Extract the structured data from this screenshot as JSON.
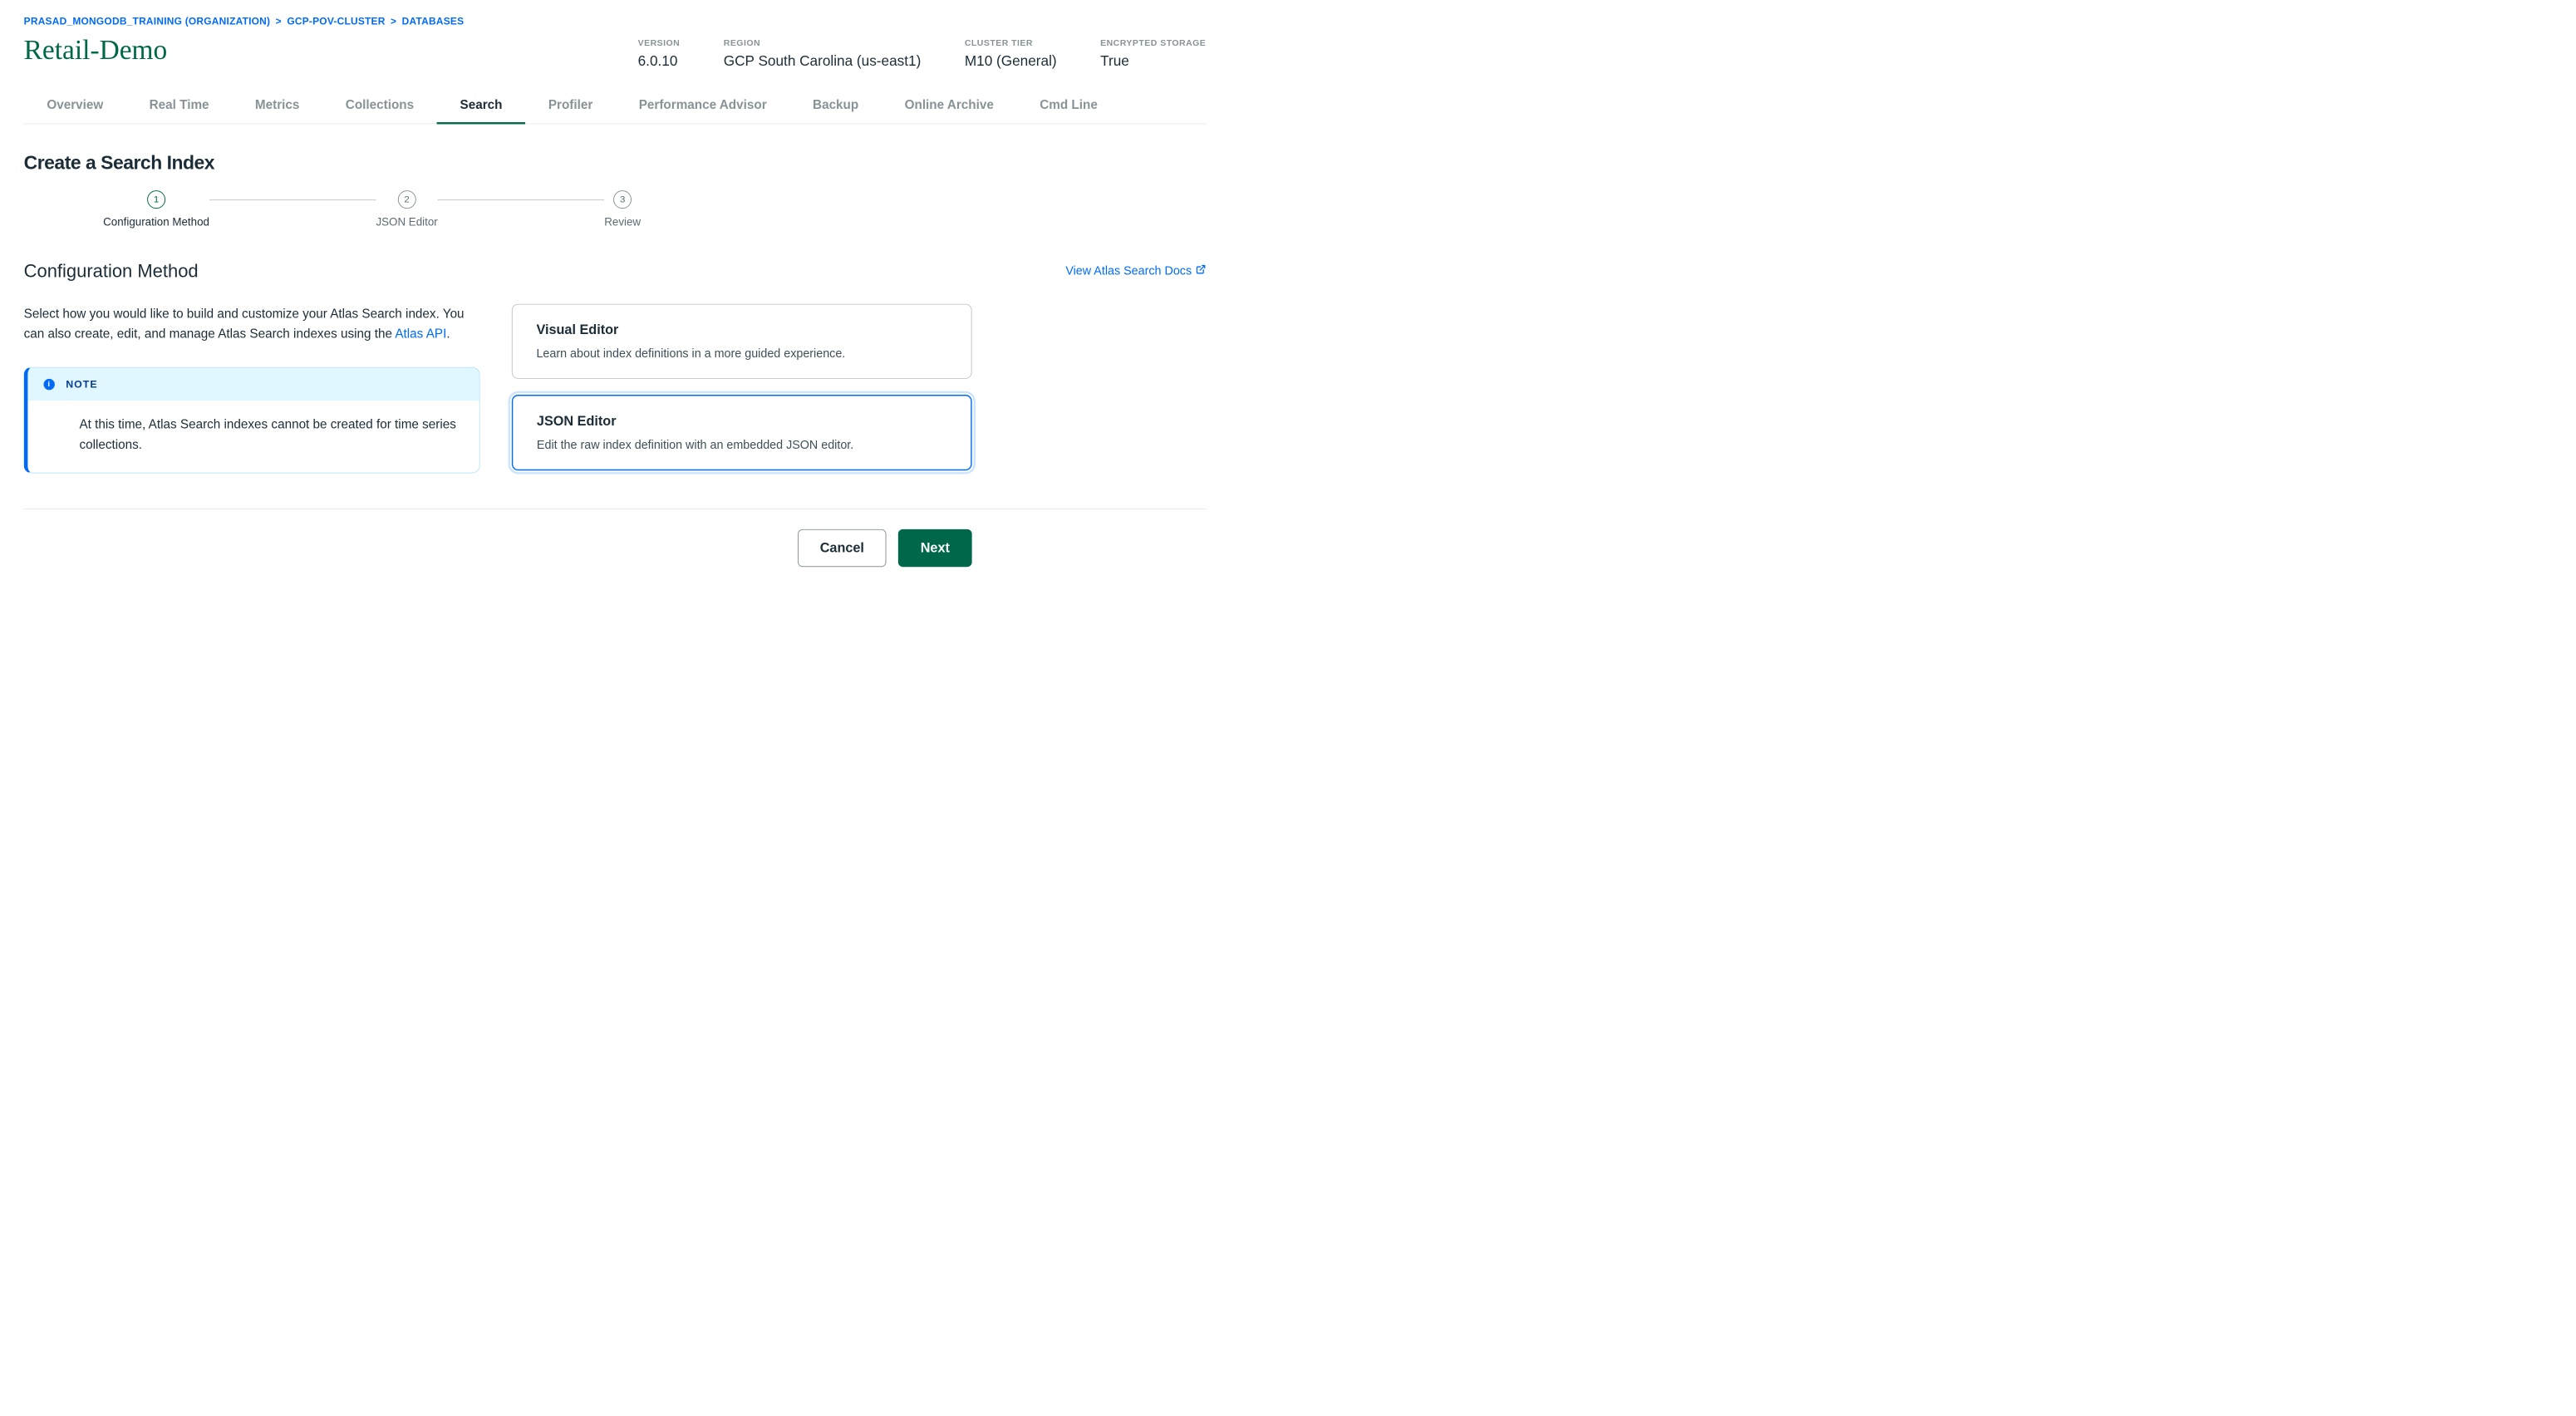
{
  "breadcrumb": {
    "org": "PRASAD_MONGODB_TRAINING (ORGANIZATION)",
    "project": "GCP-POV-CLUSTER",
    "section": "DATABASES"
  },
  "cluster_title": "Retail-Demo",
  "meta": {
    "version_label": "VERSION",
    "version_value": "6.0.10",
    "region_label": "REGION",
    "region_value": "GCP South Carolina (us-east1)",
    "tier_label": "CLUSTER TIER",
    "tier_value": "M10 (General)",
    "encrypted_label": "ENCRYPTED STORAGE",
    "encrypted_value": "True"
  },
  "tabs": [
    {
      "label": "Overview",
      "active": false
    },
    {
      "label": "Real Time",
      "active": false
    },
    {
      "label": "Metrics",
      "active": false
    },
    {
      "label": "Collections",
      "active": false
    },
    {
      "label": "Search",
      "active": true
    },
    {
      "label": "Profiler",
      "active": false
    },
    {
      "label": "Performance Advisor",
      "active": false
    },
    {
      "label": "Backup",
      "active": false
    },
    {
      "label": "Online Archive",
      "active": false
    },
    {
      "label": "Cmd Line",
      "active": false
    }
  ],
  "page_heading": "Create a Search Index",
  "stepper": [
    {
      "num": "1",
      "label": "Configuration Method",
      "active": true
    },
    {
      "num": "2",
      "label": "JSON Editor",
      "active": false
    },
    {
      "num": "3",
      "label": "Review",
      "active": false
    }
  ],
  "config": {
    "title": "Configuration Method",
    "docs_link": "View Atlas Search Docs",
    "desc_prefix": "Select how you would like to build and customize your Atlas Search index. You can also create, edit, and manage Atlas Search indexes using the ",
    "desc_link": "Atlas API",
    "desc_suffix": "."
  },
  "note": {
    "label": "NOTE",
    "body": "At this time, Atlas Search indexes cannot be created for time series collections."
  },
  "options": [
    {
      "title": "Visual Editor",
      "desc": "Learn about index definitions in a more guided experience.",
      "selected": false
    },
    {
      "title": "JSON Editor",
      "desc": "Edit the raw index definition with an embedded JSON editor.",
      "selected": true
    }
  ],
  "buttons": {
    "cancel": "Cancel",
    "next": "Next"
  }
}
